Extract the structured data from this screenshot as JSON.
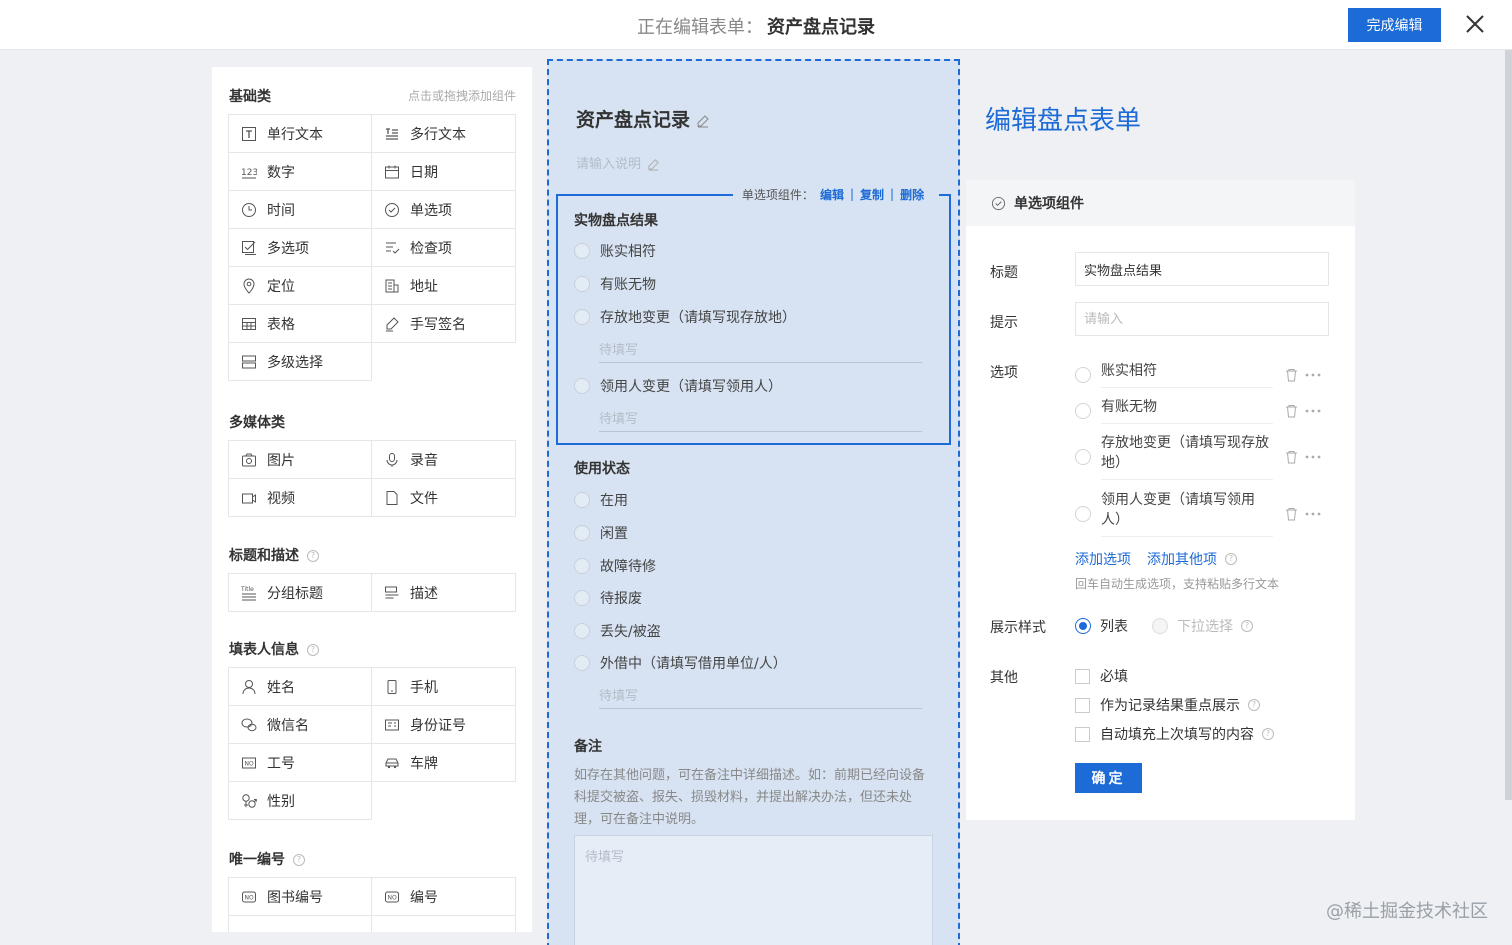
{
  "header": {
    "editing_prefix": "正在编辑表单：",
    "form_name": "资产盘点记录",
    "done_label": "完成编辑"
  },
  "palette": {
    "hint": "点击或拖拽添加组件",
    "sections": {
      "basic": {
        "title": "基础类",
        "items": [
          "单行文本",
          "多行文本",
          "数字",
          "日期",
          "时间",
          "单选项",
          "多选项",
          "检查项",
          "定位",
          "地址",
          "表格",
          "手写签名",
          "多级选择"
        ]
      },
      "media": {
        "title": "多媒体类",
        "items": [
          "图片",
          "录音",
          "视频",
          "文件"
        ]
      },
      "titles": {
        "title": "标题和描述",
        "items": [
          "分组标题",
          "描述"
        ]
      },
      "filler": {
        "title": "填表人信息",
        "items": [
          "姓名",
          "手机",
          "微信名",
          "身份证号",
          "工号",
          "车牌",
          "性别"
        ]
      },
      "unique": {
        "title": "唯一编号",
        "items": [
          "图书编号",
          "编号"
        ]
      }
    }
  },
  "canvas": {
    "title": "资产盘点记录",
    "desc_placeholder": "请输入说明",
    "toolbar": {
      "prefix": "单选项组件：",
      "edit": "编辑",
      "copy": "复制",
      "delete": "删除"
    },
    "q1": {
      "label": "实物盘点结果",
      "options": [
        "账实相符",
        "有账无物",
        "存放地变更（请填写现存放地）",
        "领用人变更（请填写领用人）"
      ],
      "fill_placeholder": "待填写"
    },
    "q2": {
      "label": "使用状态",
      "options": [
        "在用",
        "闲置",
        "故障待修",
        "待报废",
        "丢失/被盗",
        "外借中（请填写借用单位/人）"
      ],
      "fill_placeholder": "待填写"
    },
    "q3": {
      "label": "备注",
      "desc": "如存在其他问题，可在备注中详细描述。如：前期已经向设备科提交被盗、报失、损毁材料，并提出解决办法，但还未处理，可在备注中说明。",
      "placeholder": "待填写"
    }
  },
  "editor": {
    "page_title": "编辑盘点表单",
    "panel_title": "单选项组件",
    "labels": {
      "title": "标题",
      "hint": "提示",
      "options": "选项",
      "display": "展示样式",
      "other": "其他"
    },
    "title_value": "实物盘点结果",
    "hint_placeholder": "请输入",
    "options": [
      "账实相符",
      "有账无物",
      "存放地变更（请填写现存放地）",
      "领用人变更（请填写领用人）"
    ],
    "add_option": "添加选项",
    "add_other": "添加其他项",
    "add_hint": "回车自动生成选项，支持粘贴多行文本",
    "display_list": "列表",
    "display_dropdown": "下拉选择",
    "checkbox_required": "必填",
    "checkbox_highlight": "作为记录结果重点展示",
    "checkbox_autofill": "自动填充上次填写的内容",
    "ok_label": "确定"
  },
  "watermark": "@稀土掘金技术社区",
  "colors": {
    "accent": "#1d6bd6",
    "canvas_bg": "#d7e3f2"
  }
}
